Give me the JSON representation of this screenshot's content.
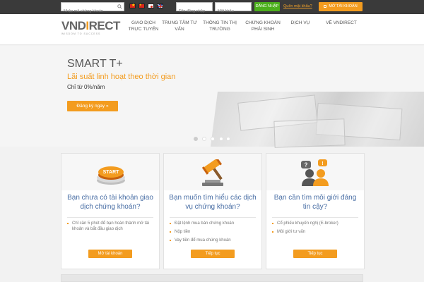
{
  "topbar": {
    "search_placeholder": "Nhập mã chứng khoán",
    "username_placeholder": "Tên đăng nhập",
    "password_placeholder": "Mật khẩu",
    "login_label": "ĐĂNG NHẬP",
    "forgot_label": "Quên mật khẩu?",
    "open_account_label": "MỞ TÀI KHOẢN",
    "languages": [
      "vi",
      "zh",
      "ja",
      "en"
    ]
  },
  "header": {
    "logo_text_main": "VND",
    "logo_text_accent": "I",
    "logo_text_rest": "RECT",
    "logo_tagline": "WISDOM TO SUCCESS",
    "nav": [
      "GIAO DỊCH\nTRỰC TUYẾN",
      "TRUNG TÂM TƯ\nVẤN",
      "THÔNG TIN THỊ\nTRƯỜNG",
      "CHỨNG KHOÁN\nPHÁI SINH",
      "DỊCH VỤ",
      "VỀ VNDIRECT"
    ]
  },
  "banner": {
    "title": "SMART T+",
    "subtitle": "Lãi suất linh hoạt theo thời gian",
    "rate": "Chỉ từ 0%/năm",
    "cta": "Đăng ký ngay »",
    "slide_count": 4,
    "active_slide": 1
  },
  "cards": [
    {
      "icon": "start-button-icon",
      "icon_text": "START",
      "title": "Bạn chưa có tài khoản giao dịch chứng khoán?",
      "items": [
        "Chỉ cần 5 phút để bạn hoàn thành mở tài khoản và bắt đầu giao dịch"
      ],
      "button": "Mở tài khoản"
    },
    {
      "icon": "gavel-icon",
      "title": "Bạn muốn tìm hiểu các dịch vụ chứng khoán?",
      "items": [
        "Đặt lệnh mua bán chứng khoán",
        "Nộp tiền",
        "Vay tiền để mua chứng khoán"
      ],
      "button": "Tiếp tục"
    },
    {
      "icon": "advisor-chat-icon",
      "title": "Bạn cần tìm môi giới đáng tin cậy?",
      "items": [
        "Cổ phiếu khuyến nghị (E-broker)",
        "Môi giới tư vấn"
      ],
      "button": "Tiếp tục"
    }
  ],
  "colors": {
    "accent": "#f39c1f",
    "topbar": "#3a3a3a",
    "login_green": "#4caf1c",
    "card_title": "#4a6fa5"
  }
}
